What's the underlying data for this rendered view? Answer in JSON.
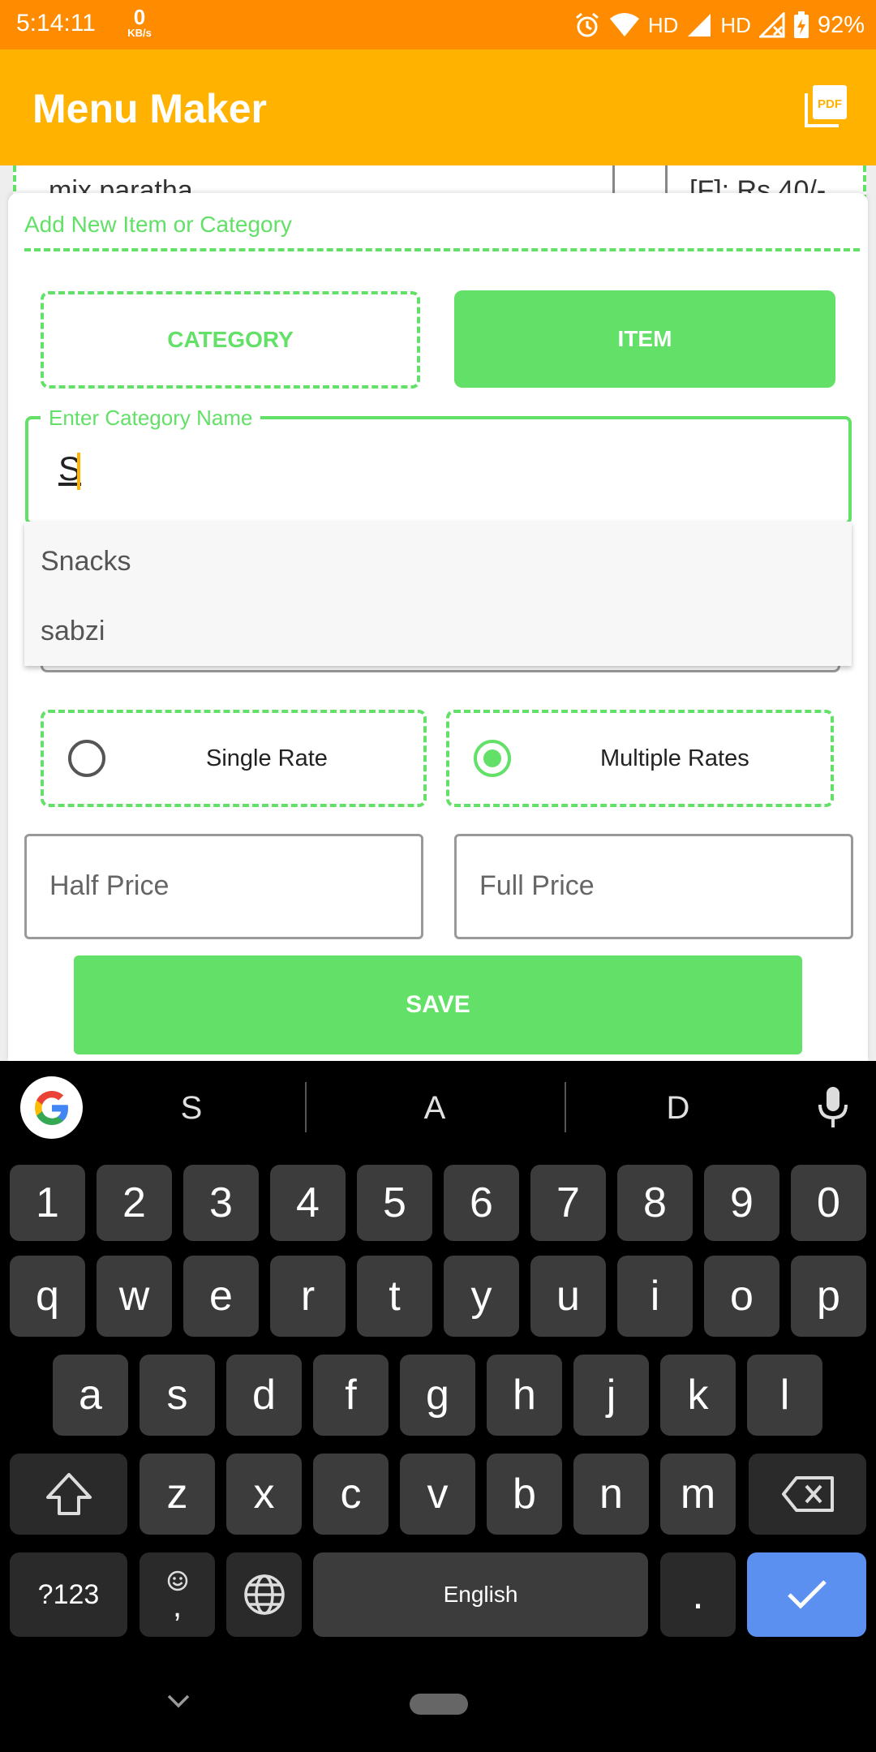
{
  "status_bar": {
    "time": "5:14:11",
    "net_speed_value": "0",
    "net_speed_unit": "KB/s",
    "network_label_1": "HD",
    "network_label_2": "HD",
    "battery": "92%"
  },
  "app_bar": {
    "title": "Menu Maker",
    "pdf_icon_text": "PDF"
  },
  "background_list": {
    "row_name": "mix paratha",
    "row_price": "[F]: Rs 40/-"
  },
  "dialog": {
    "title": "Add New Item or Category",
    "toggle_category": "CATEGORY",
    "toggle_item": "ITEM",
    "category_field_label": "Enter Category Name",
    "category_field_value": "S",
    "suggestions": [
      "Snacks",
      "sabzi"
    ],
    "rate_single": "Single Rate",
    "rate_multiple": "Multiple Rates",
    "rate_selected": "Multiple Rates",
    "half_price_placeholder": "Half Price",
    "full_price_placeholder": "Full Price",
    "save_label": "SAVE"
  },
  "keyboard": {
    "suggestions": [
      "S",
      "A",
      "D"
    ],
    "row_numbers": [
      "1",
      "2",
      "3",
      "4",
      "5",
      "6",
      "7",
      "8",
      "9",
      "0"
    ],
    "row_1": [
      "q",
      "w",
      "e",
      "r",
      "t",
      "y",
      "u",
      "i",
      "o",
      "p"
    ],
    "row_2": [
      "a",
      "s",
      "d",
      "f",
      "g",
      "h",
      "j",
      "k",
      "l"
    ],
    "row_3": [
      "z",
      "x",
      "c",
      "v",
      "b",
      "n",
      "m"
    ],
    "symbols_key": "?123",
    "comma_key": ",",
    "space_label": "English",
    "period_key": "."
  },
  "colors": {
    "status_bar": "#ff8c00",
    "app_bar": "#ffb300",
    "accent_green": "#62e067",
    "enter_key": "#5b8ff0"
  }
}
